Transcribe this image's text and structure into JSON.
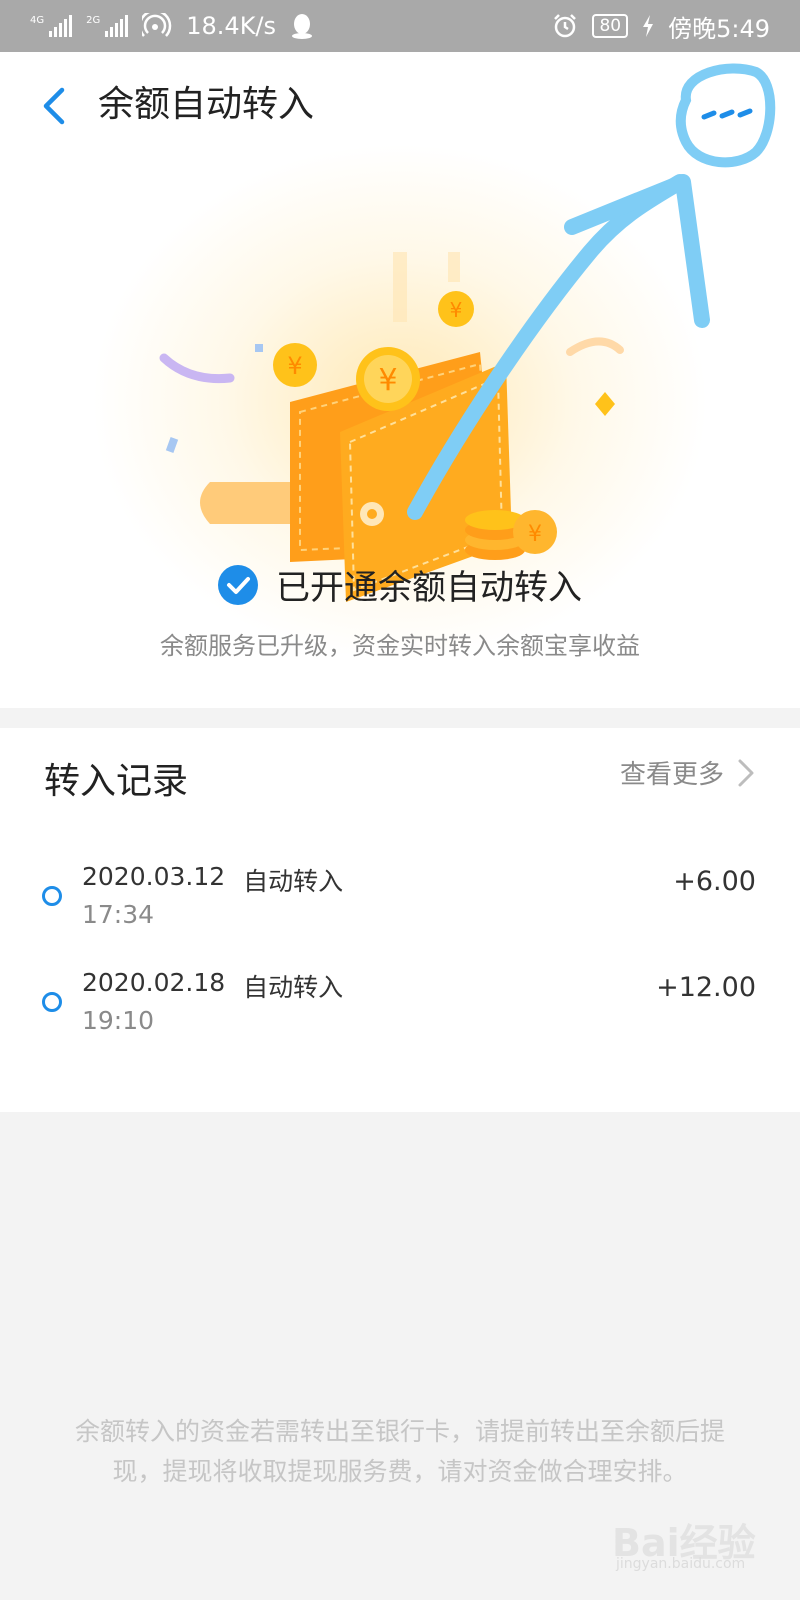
{
  "status_bar": {
    "net1": "4G",
    "net2": "2G",
    "speed": "18.4K/s",
    "battery": "80",
    "time": "傍晚5:49"
  },
  "header": {
    "title": "余额自动转入",
    "back_icon": "chevron-left-icon",
    "more_icon": "more-dots-icon"
  },
  "status": {
    "opened_text": "已开通余额自动转入",
    "subtitle": "余额服务已升级，资金实时转入余额宝享收益"
  },
  "records": {
    "title": "转入记录",
    "view_more": "查看更多",
    "items": [
      {
        "date": "2020.03.12",
        "type": "自动转入",
        "time": "17:34",
        "amount": "+6.00"
      },
      {
        "date": "2020.02.18",
        "type": "自动转入",
        "time": "19:10",
        "amount": "+12.00"
      }
    ]
  },
  "footer_note": "余额转入的资金若需转出至银行卡，请提前转出至余额后提现，提现将收取提现服务费，请对资金做合理安排。",
  "watermark": {
    "main": "Bai经验",
    "sub": "jingyan.baidu.com"
  },
  "colors": {
    "accent": "#1e8de8",
    "annotation": "#7fcdf5",
    "wallet": "#ffa21a"
  }
}
